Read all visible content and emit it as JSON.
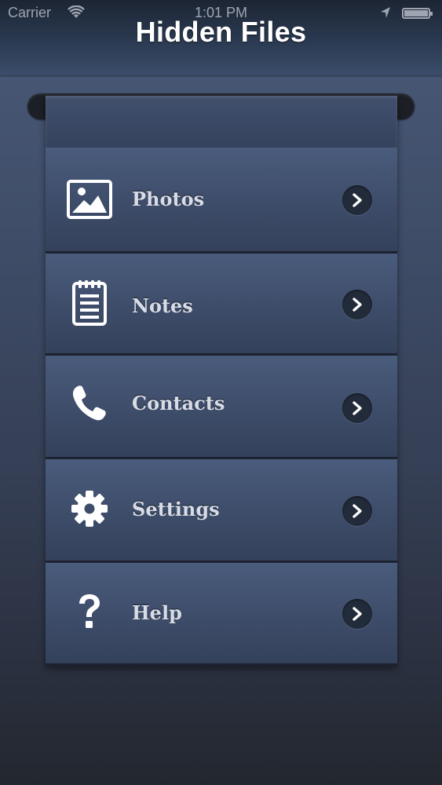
{
  "status_bar": {
    "carrier": "Carrier",
    "time": "1:01 PM",
    "wifi_icon": "wifi-icon",
    "location_icon": "location-arrow-icon",
    "battery_icon": "battery-icon",
    "battery_level": 1.0
  },
  "header": {
    "title": "Hidden Files"
  },
  "menu": {
    "items": [
      {
        "label": "Photos",
        "icon": "photo-icon",
        "chevron_icon": "chevron-right-icon"
      },
      {
        "label": "Notes",
        "icon": "notepad-icon",
        "chevron_icon": "chevron-right-icon"
      },
      {
        "label": "Contacts",
        "icon": "phone-icon",
        "chevron_icon": "chevron-right-icon"
      },
      {
        "label": "Settings",
        "icon": "gear-icon",
        "chevron_icon": "chevron-right-icon"
      },
      {
        "label": "Help",
        "icon": "question-mark-icon",
        "chevron_icon": "chevron-right-icon"
      }
    ]
  },
  "colors": {
    "title_text": "#ffffff",
    "menu_label_text": "#d8dce6",
    "row_background": "#3d4c69",
    "chevron_background": "#222b3a"
  }
}
